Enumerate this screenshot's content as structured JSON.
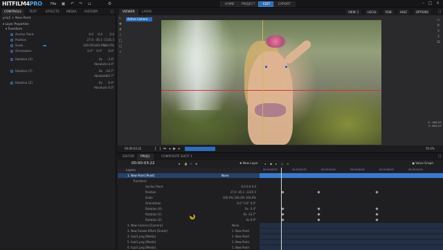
{
  "app": {
    "logo_main": "HITFILM4",
    "logo_pro": "PRO",
    "file_menu": "File"
  },
  "nav": [
    {
      "label": "HOME",
      "active": false
    },
    {
      "label": "PROJECT",
      "active": false
    },
    {
      "label": "EDIT",
      "active": true
    },
    {
      "label": "EXPORT",
      "active": false
    }
  ],
  "controls": {
    "tabs": [
      "CONTROLS",
      "TEXT",
      "EFFECTS",
      "MEDIA",
      "HISTORY"
    ],
    "breadcrumb": "proj1 > New Point",
    "section_layer_properties": "Layer Properties",
    "section_transform": "Transform",
    "rows": [
      {
        "label": "Anchor Point",
        "v1": "0.0",
        "v2": "0.0",
        "v3": "0.0"
      },
      {
        "label": "Position",
        "v1": "27.0",
        "v2": "-45.1",
        "v3": "-1145.5"
      },
      {
        "label": "Scale",
        "v1": "100.0%",
        "v2": "100.0%",
        "v3": "100.0%"
      },
      {
        "label": "Orientation",
        "v1": "0.0°",
        "v2": "0.0°",
        "v3": "0.0°"
      },
      {
        "label": "Rotation (X)",
        "v1": "",
        "v2": "0x",
        "v3": "-3.4°"
      },
      {
        "label": "",
        "v1": "",
        "v2": "Absolute:",
        "v3": "-3.4°"
      },
      {
        "label": "Rotation (Y)",
        "v1": "",
        "v2": "0x",
        "v3": "-14.7°"
      },
      {
        "label": "",
        "v1": "",
        "v2": "Absolute:",
        "v3": "-14.7°"
      },
      {
        "label": "Rotation (Z)",
        "v1": "",
        "v2": "0x",
        "v3": "0.0°"
      },
      {
        "label": "",
        "v1": "",
        "v2": "Absolute:",
        "v3": "0.0°"
      }
    ]
  },
  "viewer": {
    "tabs": [
      "VIEWER",
      "LAYER"
    ],
    "selectors": [
      "VIEW: 1",
      "LOCAL",
      "RGB",
      "HALF",
      "OPTIONS"
    ],
    "active_camera": "Active Camera",
    "coords_line1": "X: -445.25",
    "coords_line2": "Y: -624.27",
    "timecode": "00:00:03:22",
    "zoom": "50.0%"
  },
  "timeline": {
    "tabs": [
      "EDITOR",
      "PROJ1",
      "COMPOSITE SHOT 1"
    ],
    "timecode": "00:00:03:22",
    "new_layer": "New Layer",
    "value_graph": "Value Graph",
    "layers_label": "Layers",
    "ruler": [
      "00:00:00:00",
      "00:00:02:00",
      "00:00:04:00",
      "00:00:06:00",
      "00:00:08:00",
      "00:00:10:00"
    ],
    "rows": [
      {
        "label": "1. New Point [Point]",
        "right": "None",
        "selected": true,
        "indent": 0
      },
      {
        "label": "Transform",
        "right": "",
        "selected": false,
        "indent": 1
      },
      {
        "label": "Anchor Point",
        "right": "0.0   0.0   0.0",
        "selected": false,
        "indent": 2
      },
      {
        "label": "Position",
        "right": "27.0   -45.1   -1145.5",
        "selected": false,
        "indent": 2
      },
      {
        "label": "Scale",
        "right": "100.0%   100.0%   100.0%",
        "selected": false,
        "indent": 2
      },
      {
        "label": "Orientation",
        "right": "0.0°   0.0°   0.0°",
        "selected": false,
        "indent": 2
      },
      {
        "label": "Rotation (X)",
        "right": "0x   -3.4°",
        "selected": false,
        "indent": 2
      },
      {
        "label": "Rotation (Y)",
        "right": "0x   -14.7°",
        "selected": false,
        "indent": 2
      },
      {
        "label": "Rotation (Z)",
        "right": "0x   0.0°",
        "selected": false,
        "indent": 2
      },
      {
        "label": "2. New Camera [Camera]",
        "right": "None",
        "selected": false,
        "indent": 0
      },
      {
        "label": "3. New Smoke Effect [Grade]",
        "right": "1. New Point",
        "selected": false,
        "indent": 0
      },
      {
        "label": "4. fuzz1.png [Media]",
        "right": "1. New Point",
        "selected": false,
        "indent": 0
      },
      {
        "label": "5. fuzz1.png [Media]",
        "right": "1. New Point",
        "selected": false,
        "indent": 0
      },
      {
        "label": "6. fuzz1.png [Media]",
        "right": "1. New Point",
        "selected": false,
        "indent": 0
      }
    ]
  }
}
